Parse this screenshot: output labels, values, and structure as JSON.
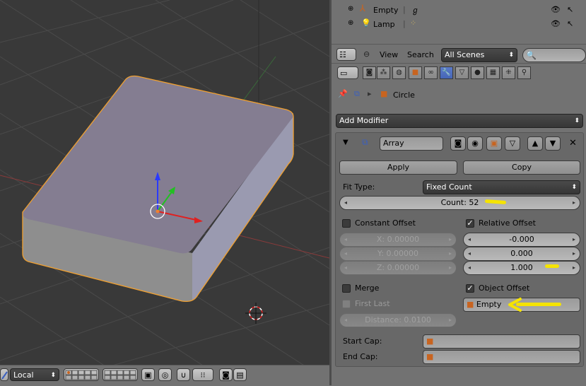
{
  "outliner": {
    "items": [
      {
        "label": "Empty",
        "icon": "empty-axes-icon",
        "constraint_icon": "constraint-icon"
      },
      {
        "label": "Lamp",
        "icon": "lamp-icon",
        "constraint_icon": "lamp-data-icon"
      }
    ]
  },
  "outliner_header": {
    "view_menu": "View",
    "search_menu": "Search",
    "scenes_select": "All Scenes",
    "search_placeholder": ""
  },
  "properties": {
    "object_name": "Circle",
    "add_modifier": "Add Modifier",
    "modifier": {
      "name": "Array",
      "apply_label": "Apply",
      "copy_label": "Copy",
      "fit_type_label": "Fit Type:",
      "fit_type_value": "Fixed Count",
      "count_label": "Count: 52",
      "constant_offset": {
        "label": "Constant Offset",
        "checked": false,
        "x": "X: 0.00000",
        "y": "Y: 0.00000",
        "z": "Z: 0.00000"
      },
      "relative_offset": {
        "label": "Relative Offset",
        "checked": true,
        "x": "-0.000",
        "y": "0.000",
        "z": "1.000"
      },
      "merge": {
        "label": "Merge",
        "checked": false
      },
      "first_last": {
        "label": "First Last",
        "checked": false
      },
      "distance": "Distance: 0.0100",
      "object_offset": {
        "label": "Object Offset",
        "checked": true,
        "object": "Empty"
      },
      "start_cap_label": "Start Cap:",
      "end_cap_label": "End Cap:"
    }
  },
  "viewport_header": {
    "pivot_select": "Local"
  },
  "colors": {
    "viewport_bg": "#393939",
    "selection_outline": "#f0a030",
    "annotation_yellow": "#f5e300",
    "active_tab": "#5b7ac8"
  }
}
